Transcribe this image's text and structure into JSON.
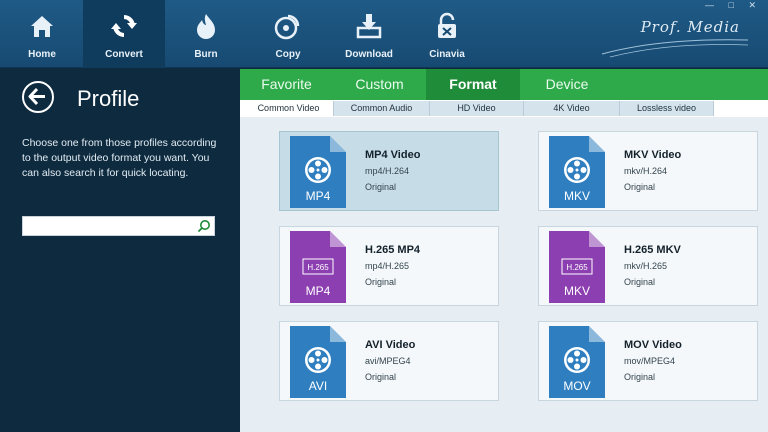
{
  "toolbar": {
    "items": [
      {
        "label": "Home",
        "icon": "home-icon"
      },
      {
        "label": "Convert",
        "icon": "convert-icon"
      },
      {
        "label": "Burn",
        "icon": "burn-icon"
      },
      {
        "label": "Copy",
        "icon": "copy-icon"
      },
      {
        "label": "Download",
        "icon": "download-icon"
      },
      {
        "label": "Cinavia",
        "icon": "cinavia-icon"
      }
    ],
    "active": "Convert",
    "brand": "Prof. Media"
  },
  "panel": {
    "title": "Profile",
    "description": "Choose one from those profiles according to the output video format you want. You can also search it for quick locating.",
    "search_value": ""
  },
  "tabs": [
    "Favorite",
    "Custom",
    "Format",
    "Device"
  ],
  "active_tab": "Format",
  "subtabs": [
    "Common Video",
    "Common Audio",
    "HD Video",
    "4K Video",
    "Lossless video"
  ],
  "active_subtab": "Common Video",
  "formats": [
    {
      "name": "MP4 Video",
      "codec": "mp4/H.264",
      "quality": "Original",
      "badge": "MP4",
      "sub": "",
      "color": "#2f7fc0"
    },
    {
      "name": "MKV Video",
      "codec": "mkv/H.264",
      "quality": "Original",
      "badge": "MKV",
      "sub": "",
      "color": "#2f7fc0"
    },
    {
      "name": "H.265 MP4",
      "codec": "mp4/H.265",
      "quality": "Original",
      "badge": "MP4",
      "sub": "H.265",
      "color": "#8c3fb0"
    },
    {
      "name": "H.265 MKV",
      "codec": "mkv/H.265",
      "quality": "Original",
      "badge": "MKV",
      "sub": "H.265",
      "color": "#8c3fb0"
    },
    {
      "name": "AVI Video",
      "codec": "avi/MPEG4",
      "quality": "Original",
      "badge": "AVI",
      "sub": "",
      "color": "#2f7fc0"
    },
    {
      "name": "MOV Video",
      "codec": "mov/MPEG4",
      "quality": "Original",
      "badge": "MOV",
      "sub": "",
      "color": "#2f7fc0"
    }
  ],
  "selected_format": "MP4 Video"
}
